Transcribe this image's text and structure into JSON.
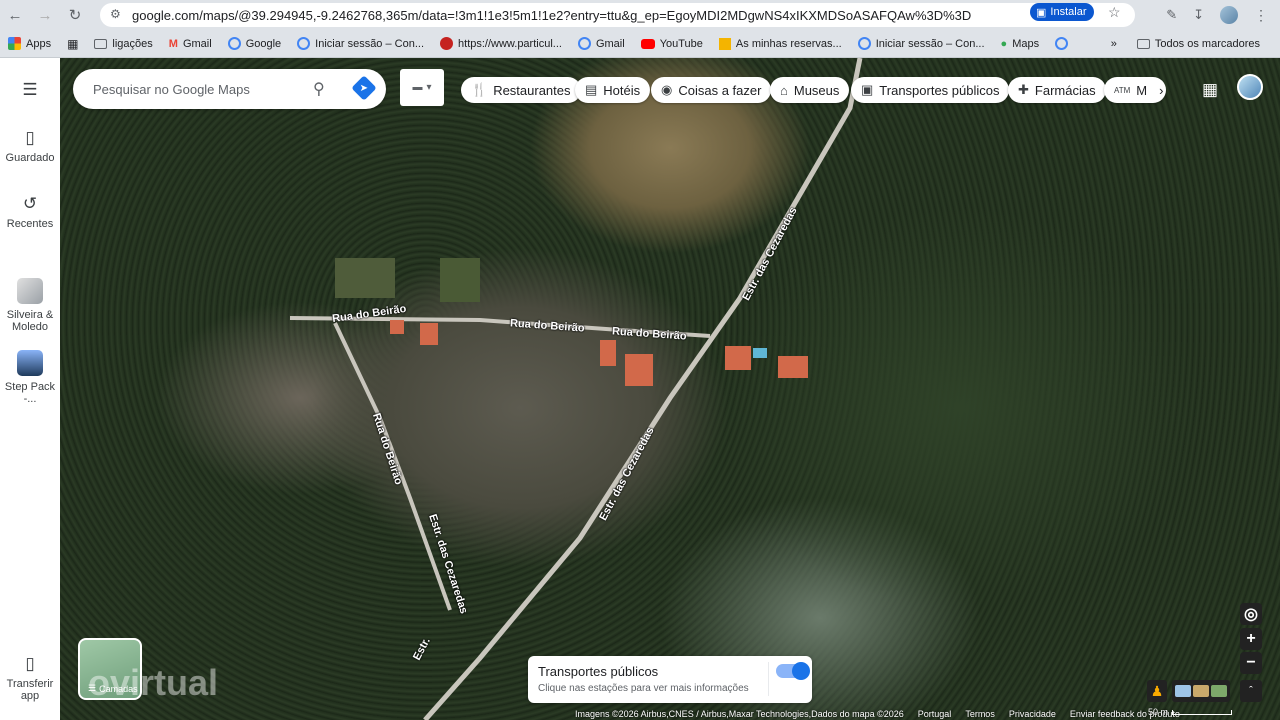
{
  "browser": {
    "url": "google.com/maps/@39.294945,-9.2462768,365m/data=!3m1!1e3!5m1!1e2?entry=ttu&g_ep=EgoyMDI2MDgwNS4xIKXMDSoASAFQAw%3D%3D",
    "install_label": "Instalar"
  },
  "bookmarks": {
    "items": [
      "Apps",
      "ligações",
      "Gmail",
      "Google",
      "Iniciar sessão – Con...",
      "https://www.particul...",
      "Gmail",
      "YouTube",
      "As minhas reservas...",
      "Iniciar sessão – Con...",
      "Maps"
    ],
    "all_label": "Todos os marcadores"
  },
  "sidebar": {
    "saved_label": "Guardado",
    "recent_label": "Recentes",
    "recent_1": "Silveira & Moledo",
    "recent_2": "Step Pack -...",
    "download_label": "Transferir app"
  },
  "search": {
    "placeholder": "Pesquisar no Google Maps"
  },
  "chips": [
    "Restaurantes",
    "Hotéis",
    "Coisas a fazer",
    "Museus",
    "Transportes públicos",
    "Farmácias",
    "M"
  ],
  "map": {
    "roads": [
      "Estr. das Cezaredas",
      "Rua do Beirão",
      "Rua do Beirão",
      "Rua do Beirão",
      "Rua do Beirão",
      "Estr. das Cezaredas",
      "Estr. das Cezaredas",
      "Estr."
    ],
    "layers_label": "Camadas",
    "watermark": "ovirtual"
  },
  "transit": {
    "title": "Transportes públicos",
    "subtitle": "Clique nas estações para ver mais informações",
    "enabled": true
  },
  "footer": {
    "attribution": "Imagens ©2026 Airbus,CNES / Airbus,Maxar Technologies,Dados do mapa ©2026",
    "country": "Portugal",
    "terms": "Termos",
    "privacy": "Privacidade",
    "feedback": "Enviar feedback do produto",
    "scale": "50 m"
  },
  "colors": {
    "accent": "#1a73e8",
    "install": "#0b57d0"
  }
}
